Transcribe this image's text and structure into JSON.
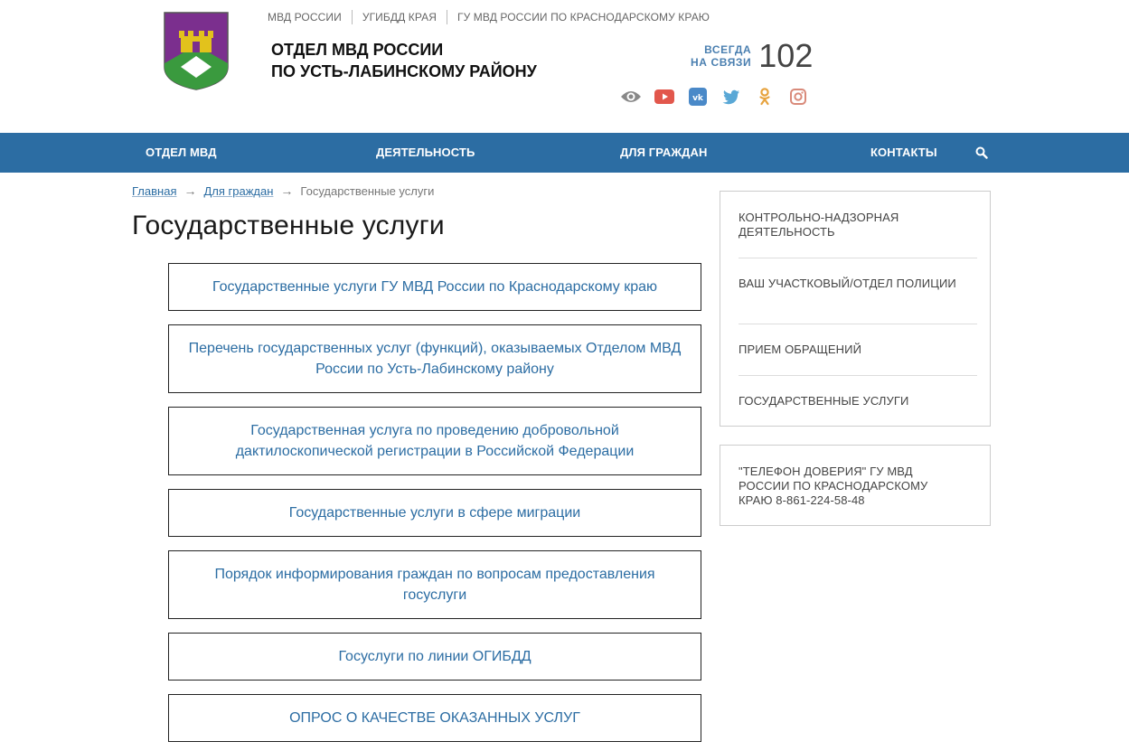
{
  "header": {
    "top_links": [
      "МВД России",
      "УГИБДД края",
      "ГУ МВД России по Краснодарскому краю"
    ],
    "title_line1": "Отдел МВД России",
    "title_line2": "по Усть-Лабинскому району",
    "hotline_label_line1": "ВСЕГДА",
    "hotline_label_line2": "НА СВЯЗИ",
    "hotline_number": "102",
    "social_icons": [
      "eye-icon",
      "youtube-icon",
      "vk-icon",
      "twitter-icon",
      "odnoklassniki-icon",
      "instagram-icon"
    ]
  },
  "nav": {
    "items": [
      "Отдел МВД",
      "Деятельность",
      "Для граждан",
      "Контакты"
    ],
    "search_icon": "search-icon"
  },
  "breadcrumb": {
    "home": "Главная",
    "parent": "Для граждан",
    "current": "Государственные услуги"
  },
  "page_title": "Государственные услуги",
  "services": [
    "Государственные услуги ГУ МВД России по Краснодарскому краю",
    "Перечень государственных услуг (функций), оказываемых Отделом МВД России по Усть-Лабинскому району",
    "Государственная услуга по проведению добровольной дактилоскопической регистрации в Российской Федерации",
    "Государственные услуги в сфере миграции",
    "Порядок информирования граждан по вопросам предоставления госуслуги",
    "Госуслуги по линии ОГИБДД",
    "ОПРОС О КАЧЕСТВЕ ОКАЗАННЫХ УСЛУГ"
  ],
  "sidebar": {
    "menu": [
      "Контрольно-надзорная деятельность",
      "Ваш участковый/Отдел полиции",
      "Прием обращений",
      "Государственные услуги"
    ],
    "phone_text": "\"Телефон доверия\" ГУ МВД России по Краснодарскому краю 8-861-224-58-48"
  },
  "colors": {
    "nav_bg": "#2c6da3",
    "link": "#2c6da3",
    "hotline_label": "#4a7fb0"
  }
}
